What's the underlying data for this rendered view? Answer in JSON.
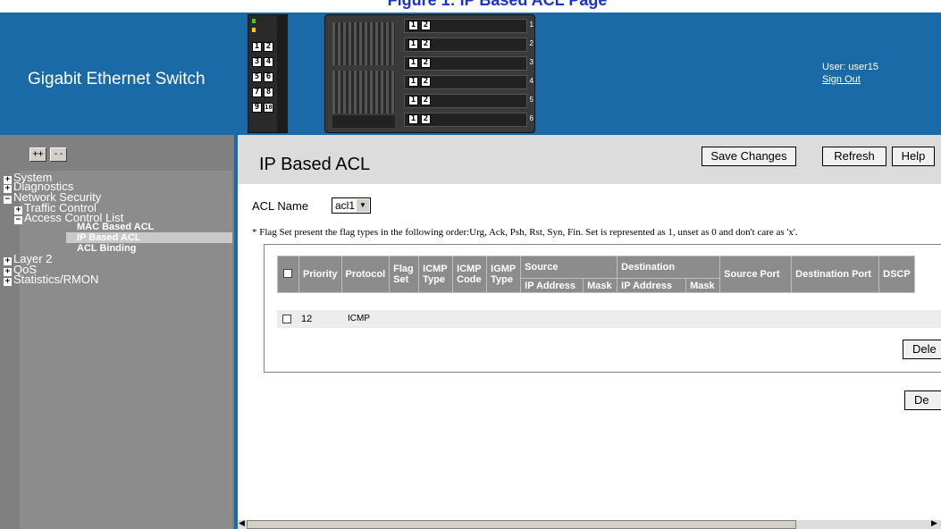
{
  "caption": "Figure 1: IP Based ACL Page",
  "header": {
    "brand": "Gigabit Ethernet Switch",
    "user_label": "User: user15",
    "signout": "Sign Out",
    "slot_numbers": [
      "1",
      "2",
      "3",
      "4",
      "5",
      "6"
    ],
    "ports_left": [
      "1",
      "2",
      "3",
      "4",
      "5",
      "6",
      "7",
      "8",
      "9",
      "10"
    ]
  },
  "tree_buttons": {
    "expand": "++",
    "collapse": "--"
  },
  "tree": [
    {
      "label": "System",
      "level": 1,
      "sign": "+"
    },
    {
      "label": "Diagnostics",
      "level": 1,
      "sign": "+"
    },
    {
      "label": "Network Security",
      "level": 1,
      "sign": "−"
    },
    {
      "label": "Traffic Control",
      "level": 2,
      "sign": "+"
    },
    {
      "label": "Access Control List",
      "level": 2,
      "sign": "−"
    },
    {
      "label": "MAC Based ACL",
      "level": 3
    },
    {
      "label": "IP Based ACL",
      "level": 3,
      "selected": true
    },
    {
      "label": "ACL Binding",
      "level": 3
    },
    {
      "label": "Layer 2",
      "level": 1,
      "sign": "+"
    },
    {
      "label": "QoS",
      "level": 1,
      "sign": "+"
    },
    {
      "label": "Statistics/RMON",
      "level": 1,
      "sign": "+"
    }
  ],
  "page": {
    "title": "IP Based ACL",
    "save": "Save Changes",
    "refresh": "Refresh",
    "help": "Help",
    "acl_label": "ACL Name",
    "acl_value": "acl1",
    "note": "* Flag Set present the flag types in the following order:Urg, Ack, Psh, Rst, Syn, Fin. Set is represented as 1, unset as 0 and don't care as 'x'.",
    "delete1": "Dele",
    "delete2": "De"
  },
  "table": {
    "headers": {
      "priority": "Priority",
      "protocol": "Protocol",
      "flag_set": "Flag Set",
      "icmp_type": "ICMP Type",
      "icmp_code": "ICMP Code",
      "igmp_type": "IGMP Type",
      "source": "Source",
      "destination": "Destination",
      "source_port": "Source Port",
      "destination_port": "Destination Port",
      "dscp": "DSCP",
      "ip_address": "IP Address",
      "mask": "Mask"
    },
    "rows": [
      {
        "priority": "12",
        "protocol": "ICMP"
      }
    ]
  }
}
